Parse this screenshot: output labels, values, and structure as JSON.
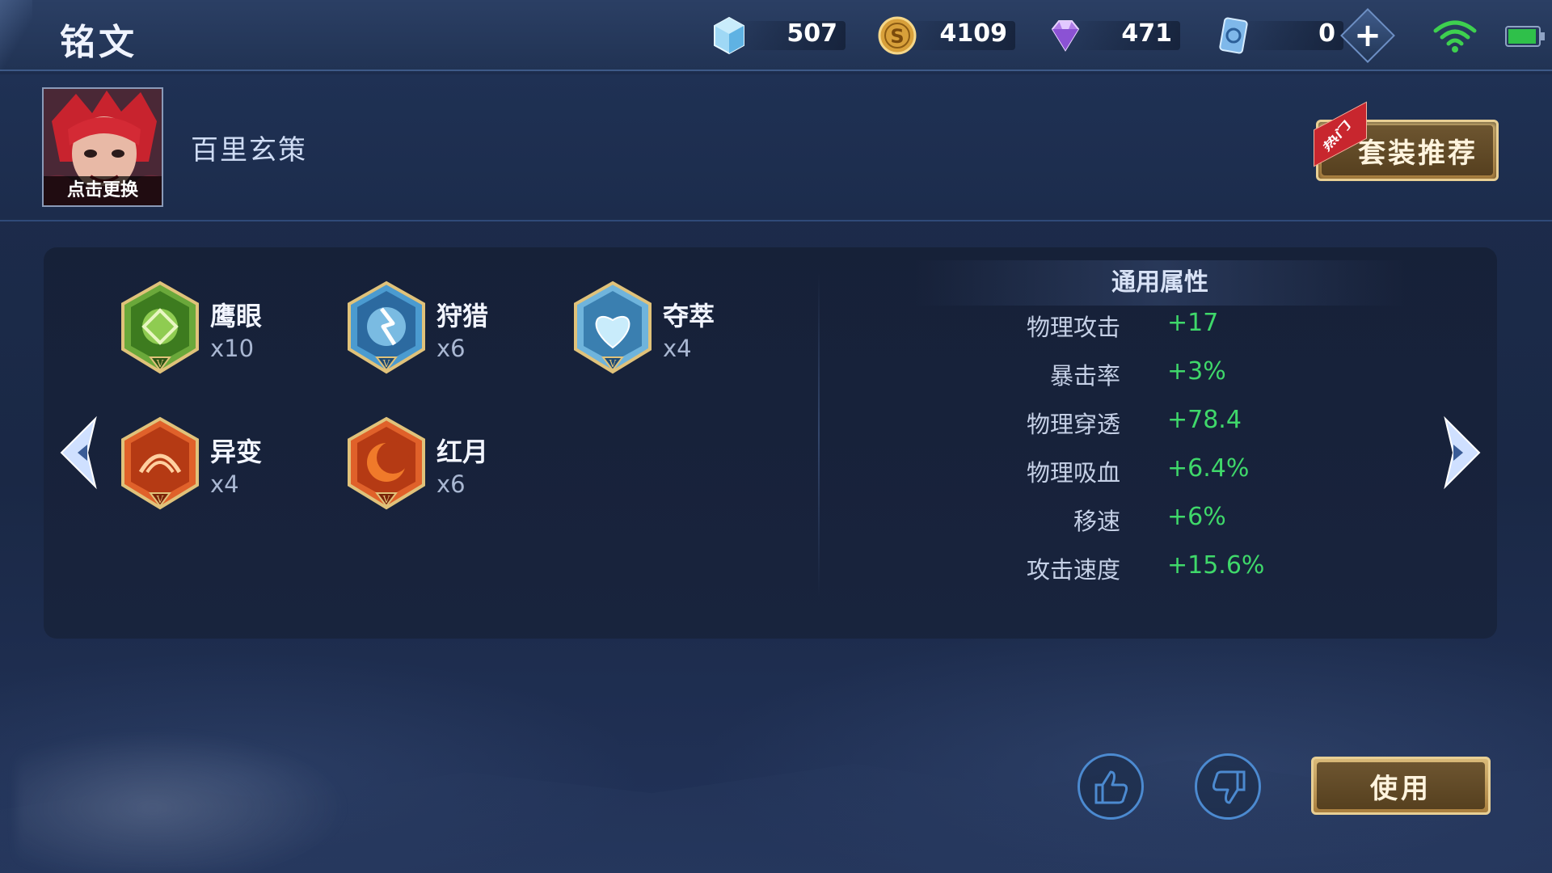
{
  "header": {
    "title": "铭文",
    "currencies": [
      {
        "name": "diamond-crystal",
        "value": "507"
      },
      {
        "name": "gold-coin",
        "value": "4109"
      },
      {
        "name": "purple-gem",
        "value": "471"
      },
      {
        "name": "ticket-card",
        "value": "0"
      }
    ],
    "add_label": "+"
  },
  "hero": {
    "avatar_label": "点击更换",
    "name": "百里玄策"
  },
  "recommend": {
    "label": "套装推荐",
    "tag": "热门"
  },
  "runes": [
    {
      "name": "鹰眼",
      "count": "x10",
      "color": "green"
    },
    {
      "name": "狩猎",
      "count": "x6",
      "color": "blue"
    },
    {
      "name": "夺萃",
      "count": "x4",
      "color": "blue"
    },
    {
      "name": "异变",
      "count": "x4",
      "color": "red"
    },
    {
      "name": "红月",
      "count": "x6",
      "color": "red"
    }
  ],
  "attributes": {
    "title": "通用属性",
    "items": [
      {
        "label": "物理攻击",
        "value": "+17"
      },
      {
        "label": "暴击率",
        "value": "+3%"
      },
      {
        "label": "物理穿透",
        "value": "+78.4"
      },
      {
        "label": "物理吸血",
        "value": "+6.4%"
      },
      {
        "label": "移速",
        "value": "+6%"
      },
      {
        "label": "攻击速度",
        "value": "+15.6%"
      }
    ]
  },
  "footer": {
    "use_label": "使用"
  },
  "colors": {
    "bonus_green": "#3fd86a",
    "gold_button": "#a97f3f",
    "accent_blue": "#4c8ad0"
  }
}
